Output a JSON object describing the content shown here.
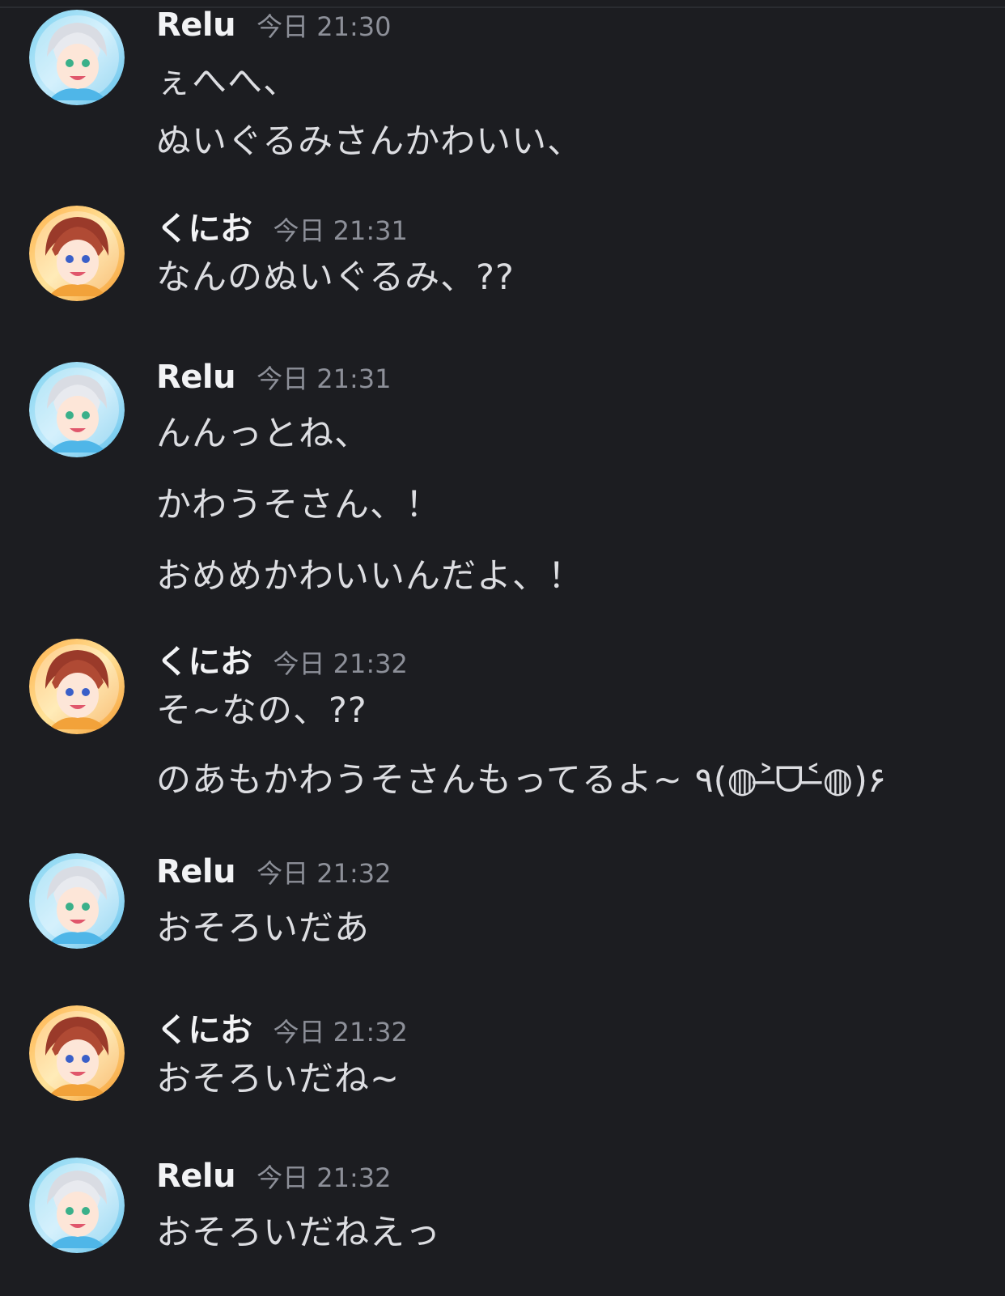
{
  "messages": [
    {
      "author": "Relu",
      "avatar": "relu-avatar",
      "time": "今日 21:30",
      "lines": [
        "ぇへへ、",
        "ぬいぐるみさんかわいい、"
      ]
    },
    {
      "author": "くにお",
      "avatar": "kunio-avatar",
      "time": "今日 21:31",
      "lines": [
        "なんのぬいぐるみ、??"
      ]
    },
    {
      "author": "Relu",
      "avatar": "relu-avatar",
      "time": "今日 21:31",
      "lines": [
        "んんっとね、",
        "かわうそさん、！",
        "おめめかわいいんだよ、！"
      ]
    },
    {
      "author": "くにお",
      "avatar": "kunio-avatar",
      "time": "今日 21:32",
      "lines": [
        "そ~なの、??",
        "のあもかわうそさんもってるよ~ ٩(◍˃̶ᗜ˂̶◍)۶"
      ]
    },
    {
      "author": "Relu",
      "avatar": "relu-avatar",
      "time": "今日 21:32",
      "lines": [
        "おそろいだあ"
      ]
    },
    {
      "author": "くにお",
      "avatar": "kunio-avatar",
      "time": "今日 21:32",
      "lines": [
        "おそろいだね~"
      ]
    },
    {
      "author": "Relu",
      "avatar": "relu-avatar",
      "time": "今日 21:32",
      "lines": [
        "おそろいだねえっ"
      ]
    }
  ],
  "colors": {
    "background": "#1c1d21",
    "username": "#f2f3f5",
    "timestamp": "#8d9099",
    "text": "#dcdde1"
  }
}
